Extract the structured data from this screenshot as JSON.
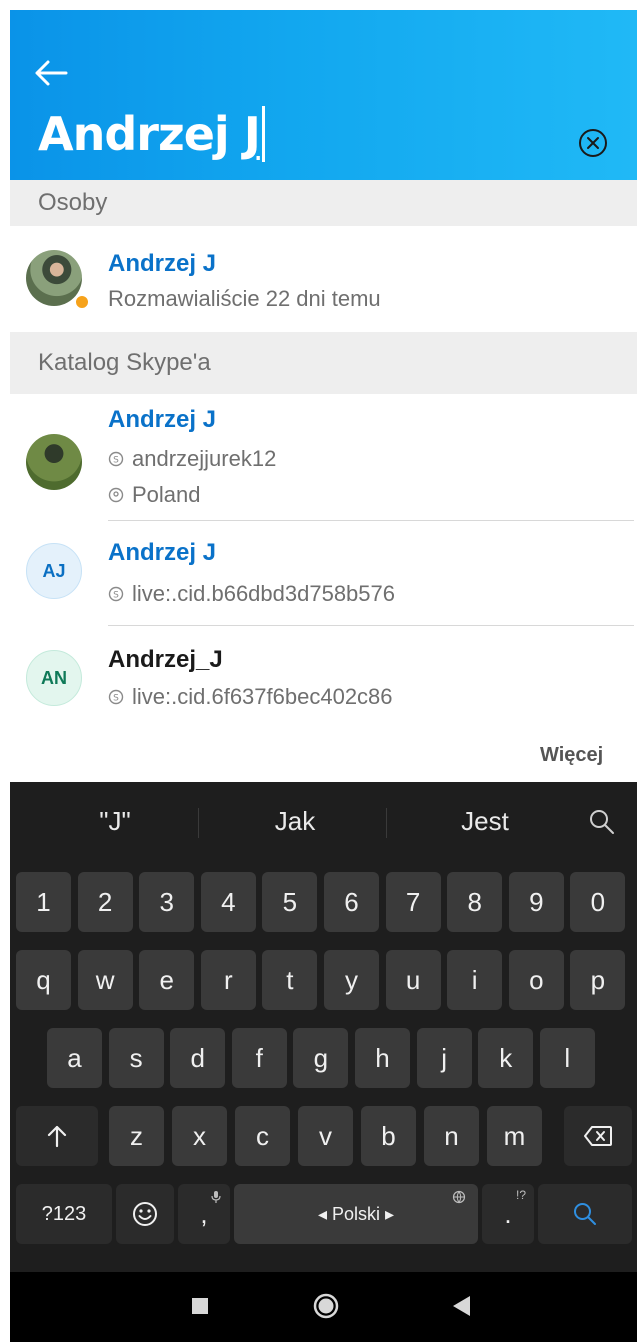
{
  "header": {
    "search_query_part1": "Andrzej ",
    "search_query_part2": "J",
    "back_icon": "arrow-left-icon",
    "clear_icon": "clear-circle-icon",
    "bg_start": "#0a93e8",
    "bg_end": "#20b9f6"
  },
  "sections": {
    "people": "Osoby",
    "directory": "Katalog Skype'a"
  },
  "people_results": [
    {
      "name": "Andrzej J",
      "subtitle": "Rozmawialiście 22 dni temu",
      "presence": "away"
    }
  ],
  "directory_results": [
    {
      "name": "Andrzej J",
      "skype_id": "andrzejjurek12",
      "location": "Poland"
    },
    {
      "name": "Andrzej J",
      "initials": "AJ",
      "skype_id": "live:.cid.b66dbd3d758b576"
    },
    {
      "name": "Andrzej_J",
      "initials": "AN",
      "skype_id": "live:.cid.6f637f6bec402c86"
    }
  ],
  "more_label": "Więcej",
  "keyboard": {
    "suggestions": [
      "\"J\"",
      "Jak",
      "Jest"
    ],
    "number_row": [
      "1",
      "2",
      "3",
      "4",
      "5",
      "6",
      "7",
      "8",
      "9",
      "0"
    ],
    "row1": [
      "q",
      "w",
      "e",
      "r",
      "t",
      "y",
      "u",
      "i",
      "o",
      "p"
    ],
    "row2": [
      "a",
      "s",
      "d",
      "f",
      "g",
      "h",
      "j",
      "k",
      "l"
    ],
    "row3": [
      "z",
      "x",
      "c",
      "v",
      "b",
      "n",
      "m"
    ],
    "symbols_label": "?123",
    "comma": ",",
    "period": ".",
    "space_label": "◂ Polski ▸",
    "period_hint": "!?"
  },
  "colors": {
    "accent": "#0a72c9",
    "presence_away": "#f6a21b",
    "keyboard_bg": "#1e1e1e",
    "key_bg": "#3a3a3a",
    "search_key_icon": "#2f8fe0"
  }
}
